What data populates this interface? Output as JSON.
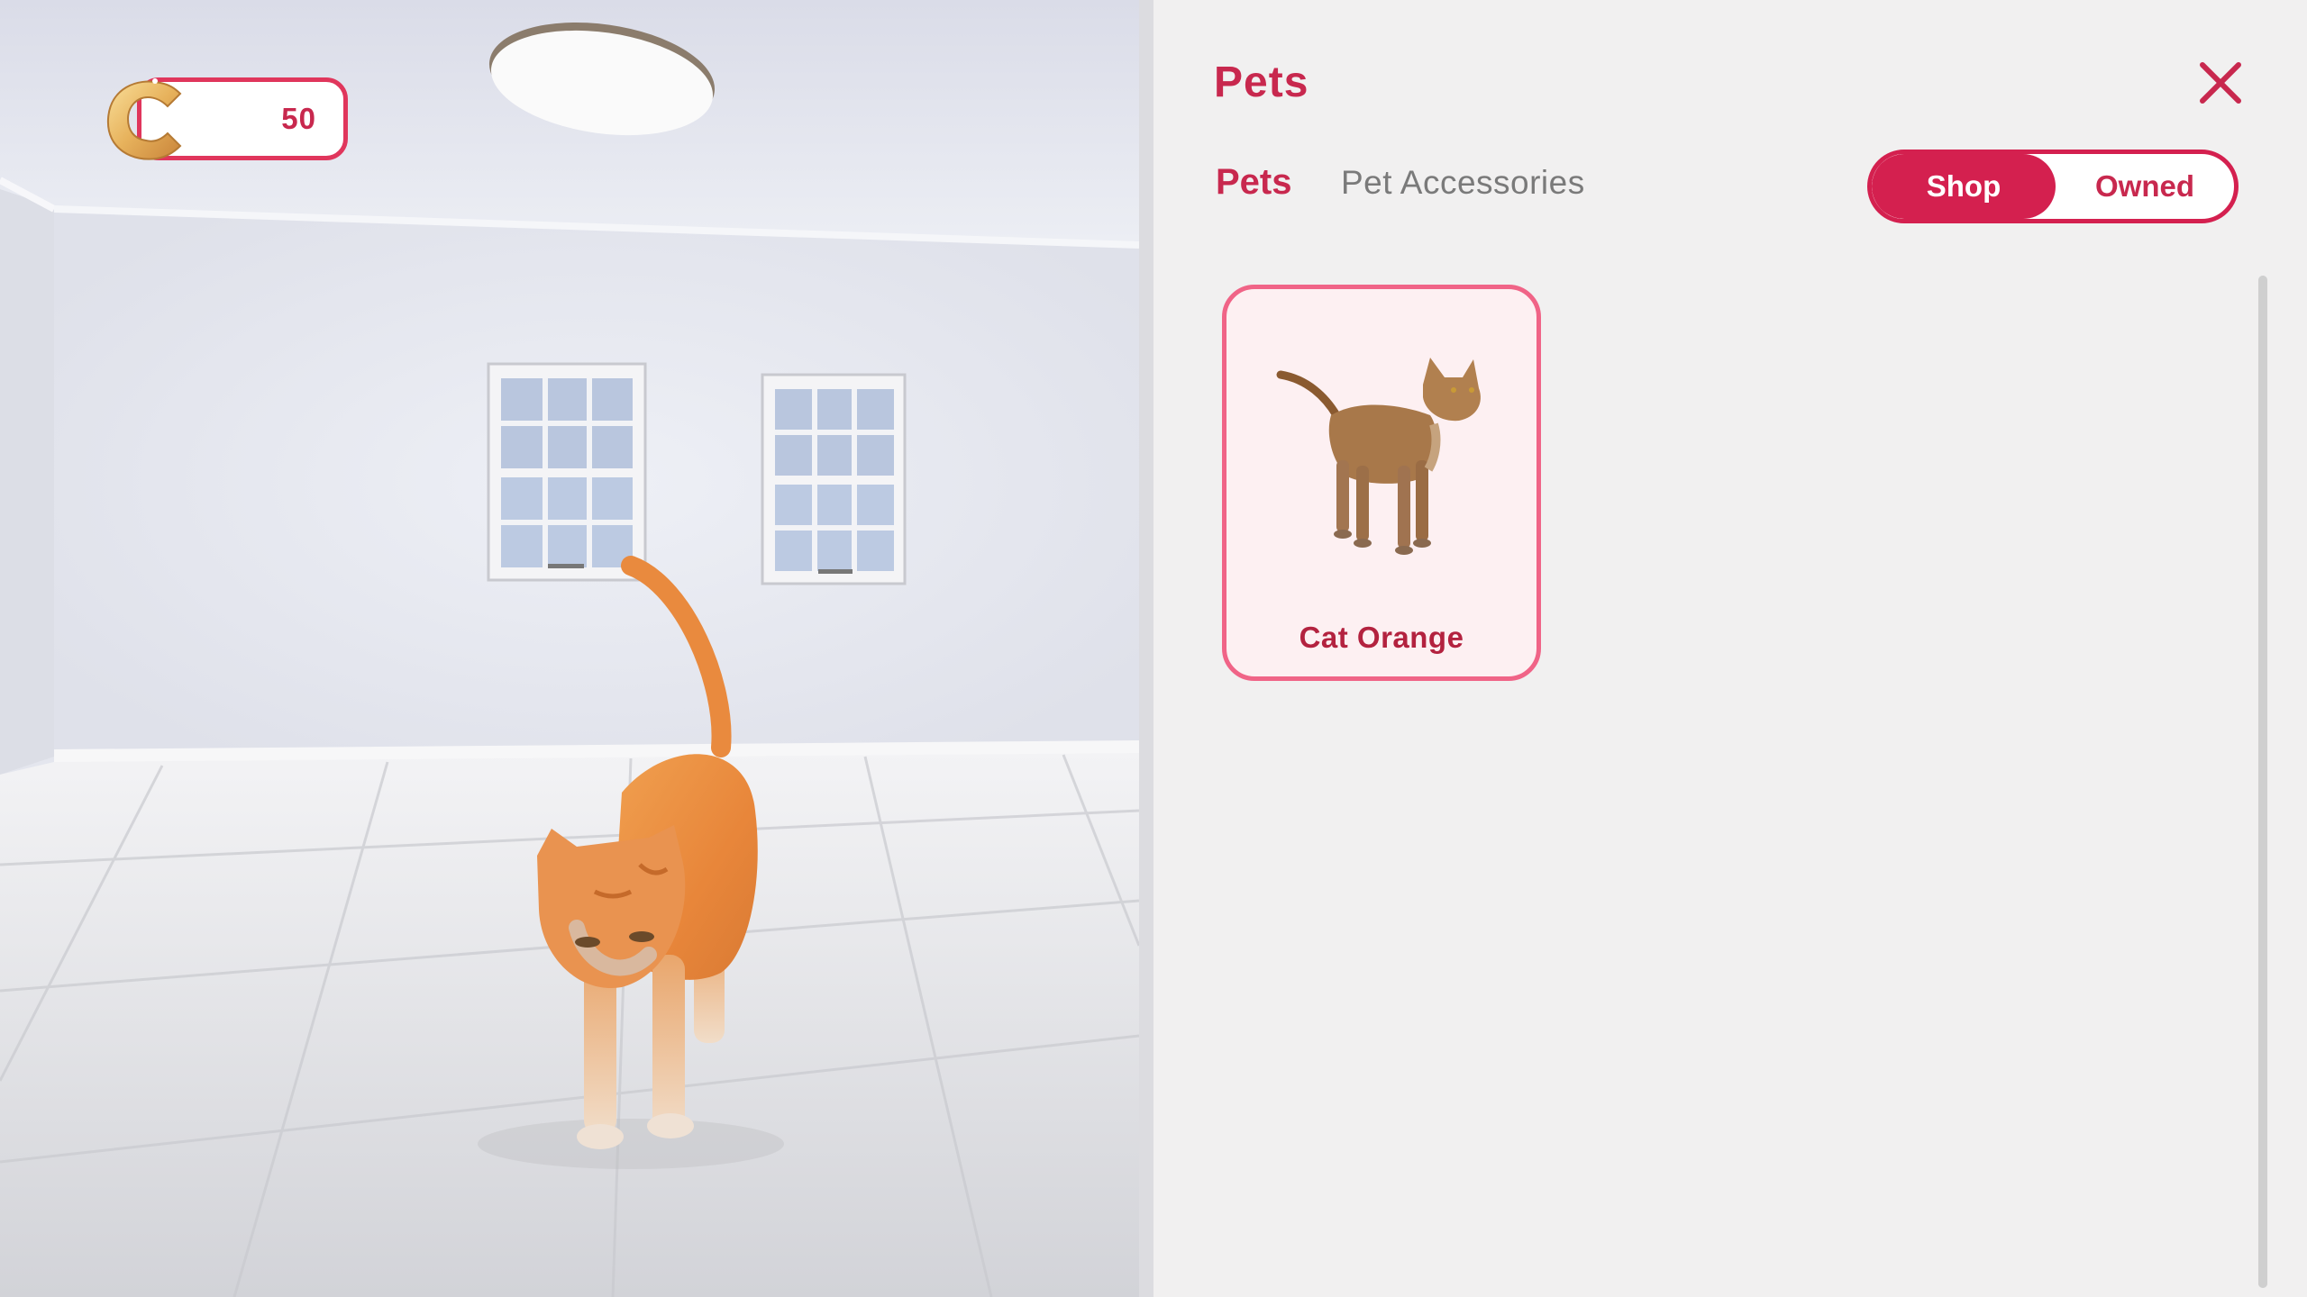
{
  "hud": {
    "coins": "50",
    "coin_icon": "coin-icon",
    "colors": {
      "accent": "#e0365c",
      "coin_gold": "#e3a84a"
    }
  },
  "panel": {
    "title": "Pets",
    "close_icon": "close-icon",
    "tabs": [
      {
        "label": "Pets",
        "active": true
      },
      {
        "label": "Pet Accessories",
        "active": false
      }
    ],
    "toggle": {
      "shop_label": "Shop",
      "owned_label": "Owned",
      "selected": "Shop"
    },
    "items": [
      {
        "name": "Cat Orange",
        "image": "cat-thumbnail"
      }
    ],
    "colors": {
      "primary": "#d4204f",
      "title": "#c8284e",
      "card_border": "#f06487",
      "card_bg": "#fdf0f2"
    }
  }
}
